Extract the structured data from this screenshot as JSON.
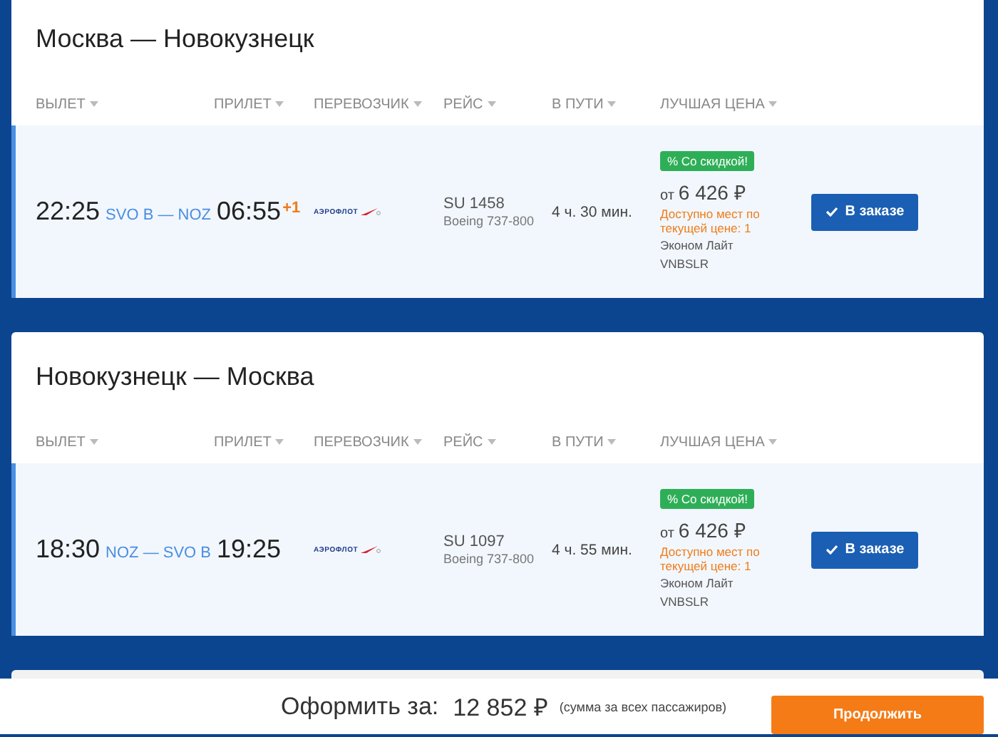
{
  "itineraries": [
    {
      "title": "Москва — Новокузнецк",
      "columns": [
        "ВЫЛЕТ",
        "ПРИЛЕТ",
        "ПЕРЕВОЗЧИК",
        "РЕЙС",
        "В ПУТИ",
        "ЛУЧШАЯ ЦЕНА"
      ],
      "flight": {
        "selected": true,
        "departure": "22:25",
        "route": "SVO B — NOZ",
        "arrival": "06:55",
        "day_shift": "+1",
        "carrier_logo": "АЭРОФЛОТ",
        "flight_number": "SU 1458",
        "aircraft": "Boeing 737-800",
        "duration": "4 ч. 30 мин.",
        "badge": "% Со скидкой!",
        "price_prefix": "от",
        "price": "6 426 ₽",
        "availability": "Доступно мест по текущей цене: 1",
        "fare": "Эконом Лайт",
        "fare_code": "VNBSLR",
        "button": "В заказе"
      }
    },
    {
      "title": "Новокузнецк — Москва",
      "columns": [
        "ВЫЛЕТ",
        "ПРИЛЕТ",
        "ПЕРЕВОЗЧИК",
        "РЕЙС",
        "В ПУТИ",
        "ЛУЧШАЯ ЦЕНА"
      ],
      "flight": {
        "selected": true,
        "departure": "18:30",
        "route": "NOZ — SVO B",
        "arrival": "19:25",
        "carrier_logo": "АЭРОФЛОТ",
        "flight_number": "SU 1097",
        "aircraft": "Boeing 737-800",
        "duration": "4 ч. 55 мин.",
        "badge": "% Со скидкой!",
        "price_prefix": "от",
        "price": "6 426 ₽",
        "availability": "Доступно мест по текущей цене: 1",
        "fare": "Эконом Лайт",
        "fare_code": "VNBSLR",
        "button": "В заказе"
      }
    }
  ],
  "footer": {
    "label": "Оформить за:",
    "total": "12 852 ₽",
    "note": "(сумма за всех пассажиров)",
    "button": "Продолжить"
  }
}
